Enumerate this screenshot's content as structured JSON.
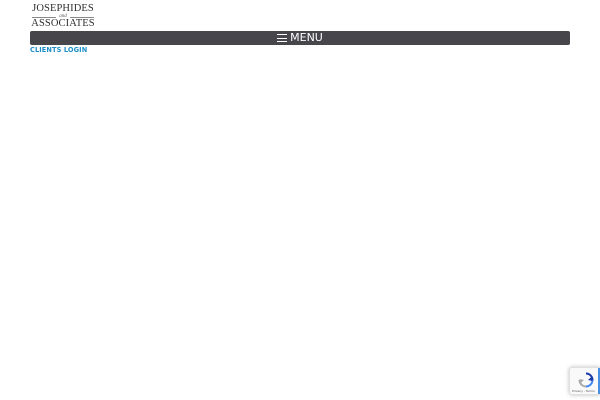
{
  "header": {
    "logo": {
      "line1": "JOSEPHIDES",
      "connector": "and",
      "line2": "ASSOCIATES"
    },
    "menu": {
      "icon": "hamburger-icon",
      "label": "MENU",
      "background_color": "#46464b"
    },
    "clients_login": {
      "label": "CLIENTS LOGIN",
      "color": "#1e8fc8"
    }
  },
  "recaptcha_badge": {
    "icon": "recaptcha-icon",
    "text": "Privacy - Terms"
  }
}
